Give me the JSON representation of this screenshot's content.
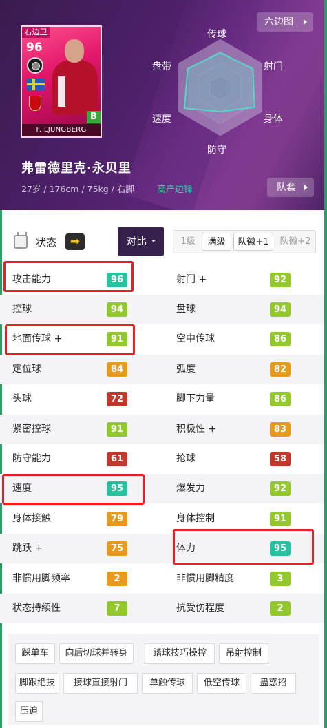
{
  "card": {
    "position": "右边卫",
    "rating": "96",
    "card_name": "F. LJUNGBERG",
    "badge": "B"
  },
  "header": {
    "hex_button": "六边图",
    "squad_button": "队套",
    "player_name": "弗雷德里克·永贝里",
    "player_info": "27岁 / 176cm / 75kg / 右脚",
    "play_style": "高产边锋"
  },
  "radar": {
    "labels": [
      "传球",
      "射门",
      "身体",
      "防守",
      "速度",
      "盘带"
    ],
    "values": [
      0.72,
      0.78,
      0.82,
      0.5,
      0.86,
      0.78
    ]
  },
  "status": {
    "label": "状态",
    "arrow": "➡",
    "compare": "对比",
    "levels": [
      "1级",
      "满级",
      "队徽+1",
      "队徽+2"
    ],
    "active_levels": [
      1,
      2
    ]
  },
  "colors": {
    "teal": "#26c3a0",
    "green": "#93c92d",
    "orange": "#e79a1d",
    "red": "#c0392b"
  },
  "stats": [
    {
      "left": {
        "name": "攻击能力",
        "value": "96",
        "color": "teal"
      },
      "right": {
        "name": "射门 +",
        "value": "92",
        "color": "green"
      }
    },
    {
      "left": {
        "name": "控球",
        "value": "94",
        "color": "green"
      },
      "right": {
        "name": "盘球",
        "value": "94",
        "color": "green"
      }
    },
    {
      "left": {
        "name": "地面传球 +",
        "value": "91",
        "color": "green"
      },
      "right": {
        "name": "空中传球",
        "value": "86",
        "color": "green"
      }
    },
    {
      "left": {
        "name": "定位球",
        "value": "84",
        "color": "orange"
      },
      "right": {
        "name": "弧度",
        "value": "82",
        "color": "orange"
      }
    },
    {
      "left": {
        "name": "头球",
        "value": "72",
        "color": "red"
      },
      "right": {
        "name": "脚下力量",
        "value": "86",
        "color": "green"
      }
    },
    {
      "left": {
        "name": "紧密控球",
        "value": "91",
        "color": "green"
      },
      "right": {
        "name": "积极性 +",
        "value": "83",
        "color": "orange"
      }
    },
    {
      "left": {
        "name": "防守能力",
        "value": "61",
        "color": "red"
      },
      "right": {
        "name": "抢球",
        "value": "58",
        "color": "red"
      }
    },
    {
      "left": {
        "name": "速度",
        "value": "95",
        "color": "teal"
      },
      "right": {
        "name": "爆发力",
        "value": "92",
        "color": "green"
      }
    },
    {
      "left": {
        "name": "身体接触",
        "value": "79",
        "color": "orange"
      },
      "right": {
        "name": "身体控制",
        "value": "91",
        "color": "green"
      }
    },
    {
      "left": {
        "name": "跳跃 +",
        "value": "75",
        "color": "orange"
      },
      "right": {
        "name": "体力",
        "value": "95",
        "color": "teal"
      }
    },
    {
      "left": {
        "name": "非惯用脚频率",
        "value": "2",
        "color": "orange"
      },
      "right": {
        "name": "非惯用脚精度",
        "value": "3",
        "color": "green"
      }
    },
    {
      "left": {
        "name": "状态持续性",
        "value": "7",
        "color": "green"
      },
      "right": {
        "name": "抗受伤程度",
        "value": "2",
        "color": "green"
      }
    }
  ],
  "skills": [
    "踩单车",
    "向后切球并转身",
    "踏球技巧操控",
    "吊射控制",
    "脚跟绝技",
    "接球直接射门",
    "单触传球",
    "低空传球",
    "蛊惑招",
    "压迫"
  ]
}
